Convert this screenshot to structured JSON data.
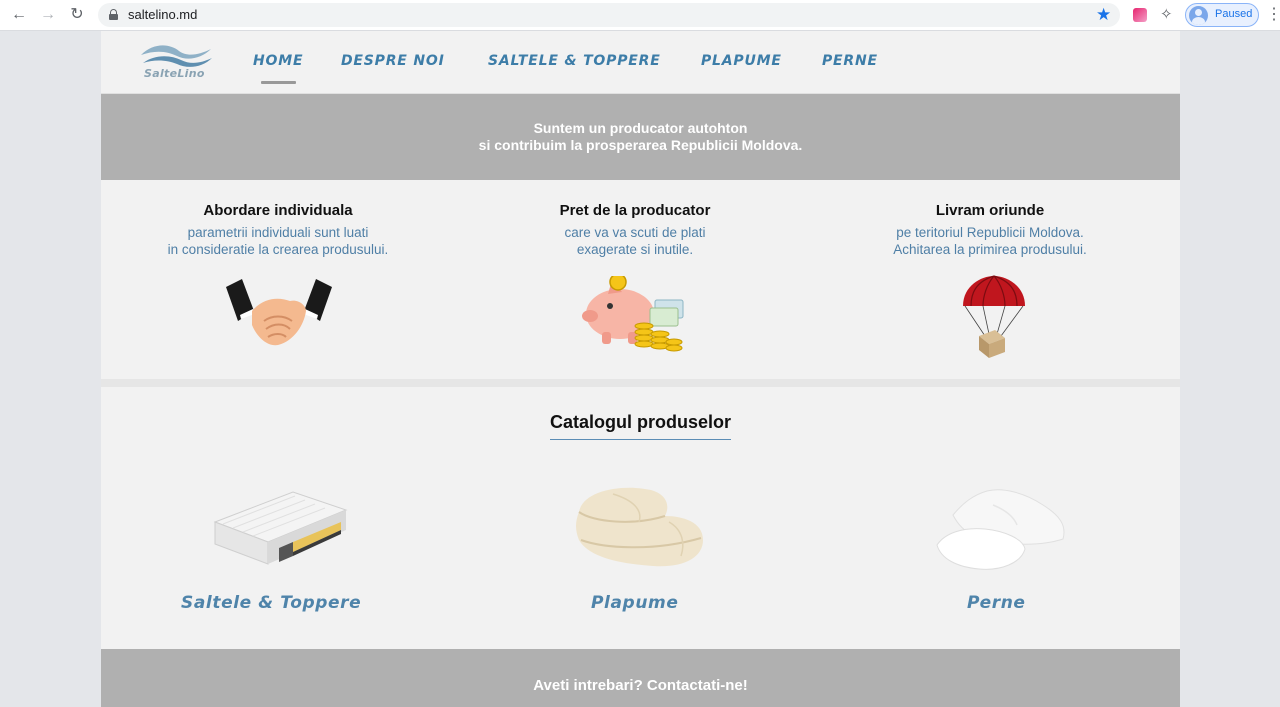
{
  "browser": {
    "url": "saltelino.md",
    "profile_status": "Paused",
    "icons": [
      "back-arrow-icon",
      "forward-arrow-icon",
      "reload-icon",
      "lock-icon",
      "bookmark-star-icon",
      "extension-icon",
      "puzzle-icon",
      "avatar-icon",
      "more-vert-icon"
    ]
  },
  "site": {
    "logo_text": "SalteLino",
    "nav": {
      "home": "HOME",
      "despre": "DESPRE NOI",
      "saltele": "SALTELE & TOPPERE",
      "plapume": "PLAPUME",
      "perne": "PERNE"
    },
    "banner": {
      "line1": "Suntem un producator autohton",
      "line2": "si contribuim la prosperarea Republicii Moldova."
    },
    "features": [
      {
        "title": "Abordare individuala",
        "line1": "parametrii individuali sunt luati",
        "line2": "in consideratie la crearea produsului.",
        "icon": "handshake-icon"
      },
      {
        "title": "Pret de la producator",
        "line1": "care va va scuti de plati",
        "line2": "exagerate si inutile.",
        "icon": "piggy-bank-icon"
      },
      {
        "title": "Livram oriunde",
        "line1": "pe teritoriul Republicii Moldova.",
        "line2": "Achitarea la primirea produsului.",
        "icon": "parachute-delivery-icon"
      }
    ],
    "catalog": {
      "title": "Catalogul produselor",
      "products": [
        {
          "label": "Saltele & Toppere",
          "icon": "mattress-icon"
        },
        {
          "label": "Plapume",
          "icon": "duvet-icon"
        },
        {
          "label": "Perne",
          "icon": "pillow-icon"
        }
      ]
    },
    "footer_text": "Aveti intrebari? Contactati-ne!",
    "colors": {
      "nav_blue": "#3d7da8",
      "text_blue": "#4f7fa6",
      "banner_gray": "#b0b0b0",
      "page_bg": "#f2f2f2"
    }
  }
}
